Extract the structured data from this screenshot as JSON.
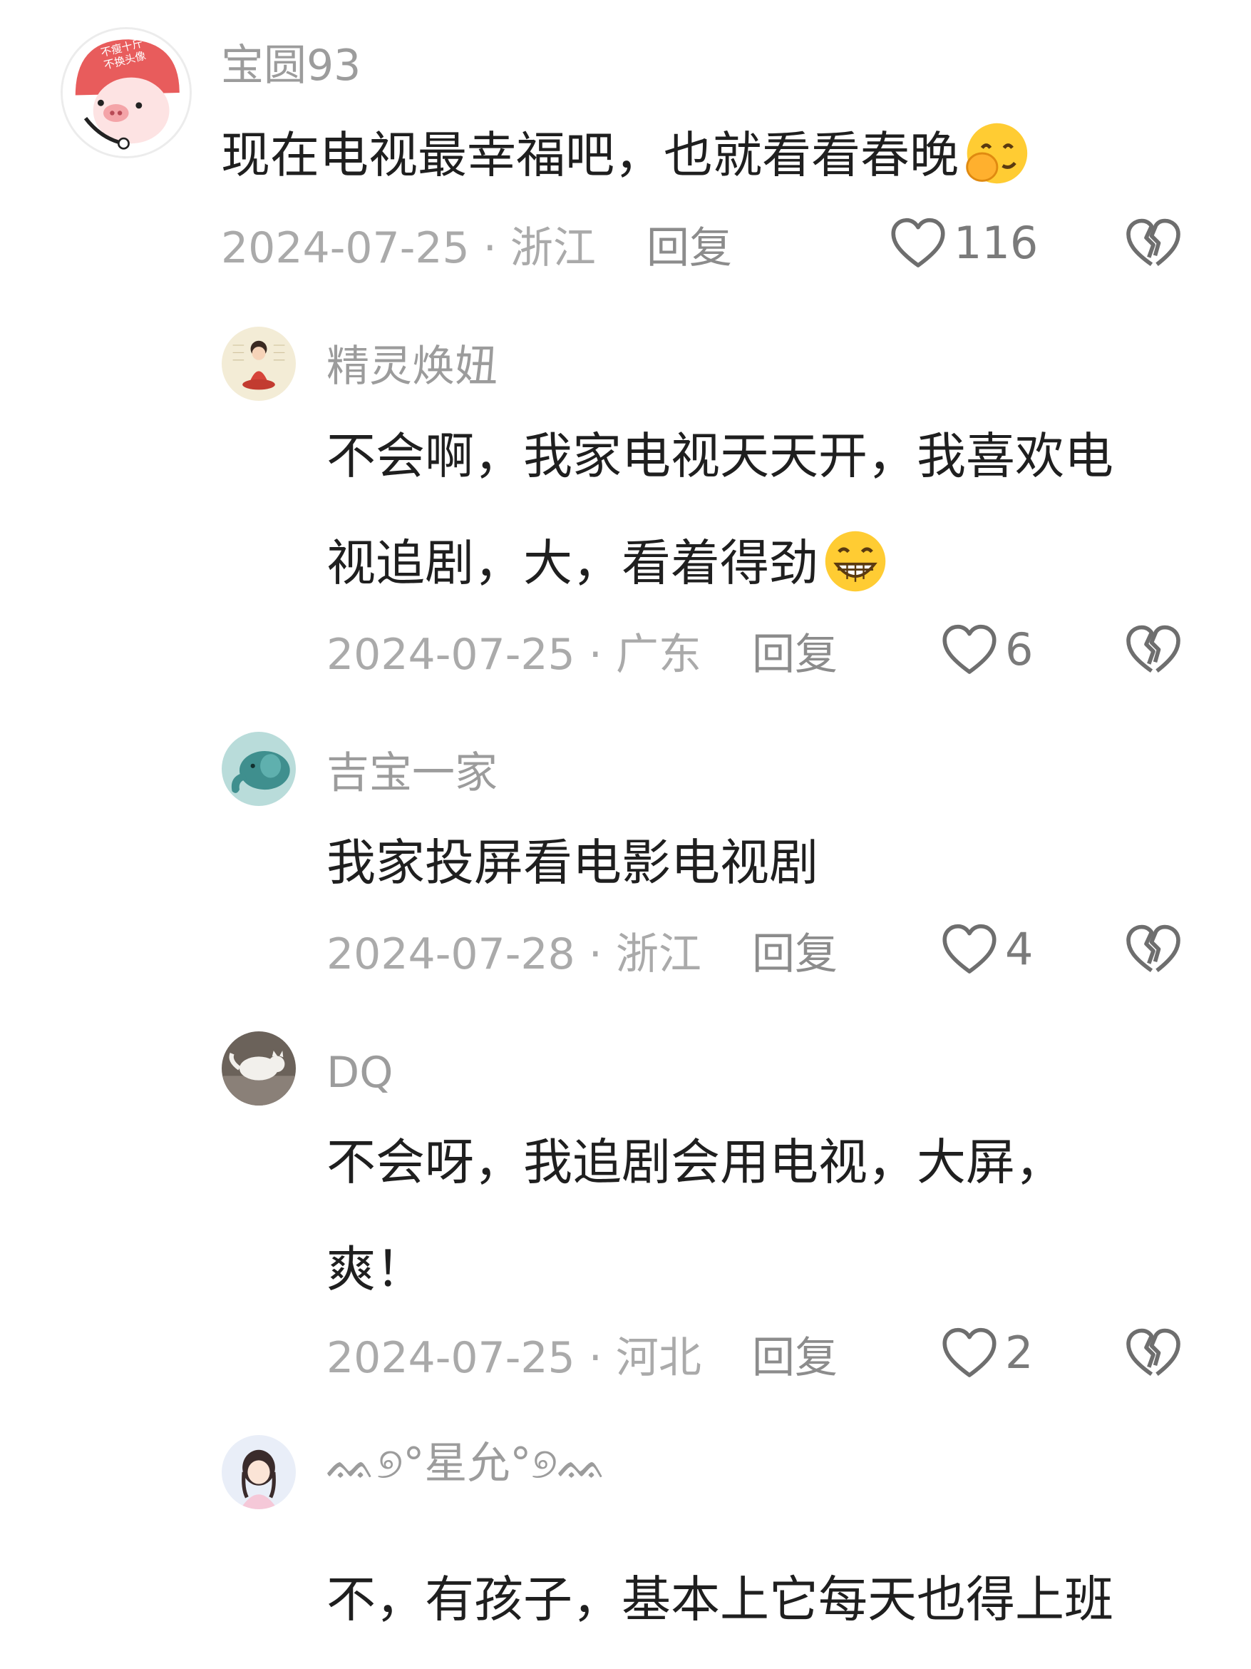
{
  "comments": [
    {
      "name": "宝圆93",
      "lines": [
        "现在电视最幸福吧，也就看看春晚"
      ],
      "date": "2024-07-25",
      "region": "浙江",
      "reply": "回复",
      "likes": "116",
      "avatar_badge_line1": "不瘦十斤",
      "avatar_badge_line2": "不换头像"
    },
    {
      "name": "精灵焕妞",
      "lines": [
        "不会啊，我家电视天天开，我喜欢电",
        "视追剧，大，看着得劲"
      ],
      "date": "2024-07-25",
      "region": "广东",
      "reply": "回复",
      "likes": "6"
    },
    {
      "name": "吉宝一家",
      "lines": [
        "我家投屏看电影电视剧"
      ],
      "date": "2024-07-28",
      "region": "浙江",
      "reply": "回复",
      "likes": "4"
    },
    {
      "name": "DQ",
      "lines": [
        "不会呀，我追剧会用电视，大屏，",
        "爽！"
      ],
      "date": "2024-07-25",
      "region": "河北",
      "reply": "回复",
      "likes": "2"
    },
    {
      "name": "ᨐ୭°星允°୭ᨐ",
      "lines": [
        "不，有孩子，基本上它每天也得上班"
      ]
    }
  ],
  "separator": " · ",
  "colors": {
    "name": "#9c9c9c",
    "text": "#1f1f1f",
    "meta": "#aaaaaa",
    "icon": "#6e6e6e"
  },
  "icons": {
    "like": "heart-outline-icon",
    "dislike": "broken-heart-icon",
    "emoji1": "shy-smile-emoji",
    "emoji2": "grin-emoji"
  }
}
